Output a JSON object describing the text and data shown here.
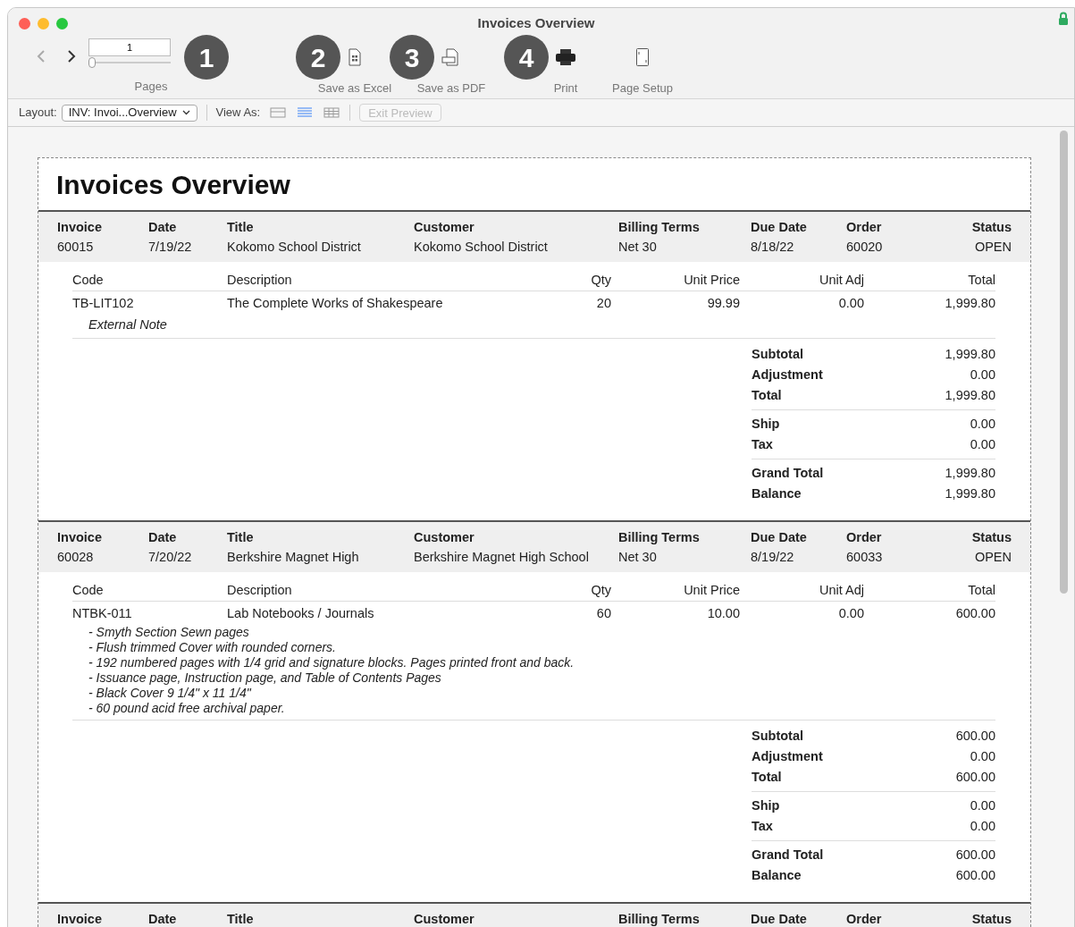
{
  "window": {
    "title": "Invoices Overview",
    "locked": true
  },
  "toolbar": {
    "page_field": {
      "value": "1"
    },
    "page_slider": {
      "level": 0
    },
    "pages_label": "Pages",
    "actions": [
      {
        "kind": "excel",
        "label": "Save as Excel"
      },
      {
        "kind": "pdf",
        "label": "Save as PDF"
      },
      {
        "kind": "print",
        "label": "Print"
      },
      {
        "kind": "setup",
        "label": "Page Setup"
      }
    ],
    "callouts": [
      "1",
      "2",
      "3",
      "4"
    ]
  },
  "layout_bar": {
    "layout_label": "Layout:",
    "layout_value": "INV: Invoi...Overview",
    "view_as_label": "View As:",
    "views": [
      {
        "kind": "form",
        "selected": false
      },
      {
        "kind": "list",
        "selected": true
      },
      {
        "kind": "table",
        "selected": false
      }
    ],
    "exit_preview": {
      "label": "Exit Preview",
      "disabled": true
    }
  },
  "report": {
    "title": "Invoices Overview",
    "invoices": [
      {
        "header": [
          {
            "label": "Invoice",
            "value": "60015"
          },
          {
            "label": "Date",
            "value": "7/19/22"
          },
          {
            "label": "Title",
            "value": "Kokomo School District"
          },
          {
            "label": "Customer",
            "value": "Kokomo School District"
          },
          {
            "label": "Billing Terms",
            "value": "Net 30"
          },
          {
            "label": "Due Date",
            "value": "8/18/22"
          },
          {
            "label": "Order",
            "value": "60020"
          },
          {
            "label": "Status",
            "value": "OPEN"
          }
        ],
        "item_columns": [
          "Code",
          "Description",
          "Qty",
          "Unit Price",
          "Unit Adj",
          "Total"
        ],
        "items": [
          {
            "cells": [
              "TB-LIT102",
              "The Complete Works of Shakespeare",
              "20",
              "99.99",
              "0.00",
              "1,999.80"
            ],
            "notes": [
              "External Note"
            ]
          }
        ],
        "totals": [
          [
            {
              "label": "Subtotal",
              "value": "1,999.80"
            },
            {
              "label": "Adjustment",
              "value": "0.00"
            },
            {
              "label": "Total",
              "value": "1,999.80"
            }
          ],
          [
            {
              "label": "Ship",
              "value": "0.00"
            },
            {
              "label": "Tax",
              "value": "0.00"
            }
          ],
          [
            {
              "label": "Grand Total",
              "value": "1,999.80"
            },
            {
              "label": "Balance",
              "value": "1,999.80"
            }
          ]
        ]
      },
      {
        "header": [
          {
            "label": "Invoice",
            "value": "60028"
          },
          {
            "label": "Date",
            "value": "7/20/22"
          },
          {
            "label": "Title",
            "value": "Berkshire Magnet High"
          },
          {
            "label": "Customer",
            "value": "Berkshire Magnet High School"
          },
          {
            "label": "Billing Terms",
            "value": "Net 30"
          },
          {
            "label": "Due Date",
            "value": "8/19/22"
          },
          {
            "label": "Order",
            "value": "60033"
          },
          {
            "label": "Status",
            "value": "OPEN"
          }
        ],
        "item_columns": [
          "Code",
          "Description",
          "Qty",
          "Unit Price",
          "Unit Adj",
          "Total"
        ],
        "items": [
          {
            "cells": [
              "NTBK-011",
              "Lab Notebooks / Journals",
              "60",
              "10.00",
              "0.00",
              "600.00"
            ],
            "notes": [
              "- Smyth Section Sewn pages",
              "- Flush trimmed Cover with rounded corners.",
              "- 192 numbered pages with 1/4 grid and signature blocks. Pages printed front and back.",
              "- Issuance page, Instruction page, and Table of Contents Pages",
              "- Black Cover 9 1/4\" x 11 1/4\"",
              "- 60 pound acid free archival paper."
            ]
          }
        ],
        "totals": [
          [
            {
              "label": "Subtotal",
              "value": "600.00"
            },
            {
              "label": "Adjustment",
              "value": "0.00"
            },
            {
              "label": "Total",
              "value": "600.00"
            }
          ],
          [
            {
              "label": "Ship",
              "value": "0.00"
            },
            {
              "label": "Tax",
              "value": "0.00"
            }
          ],
          [
            {
              "label": "Grand Total",
              "value": "600.00"
            },
            {
              "label": "Balance",
              "value": "600.00"
            }
          ]
        ]
      },
      {
        "header": [
          {
            "label": "Invoice"
          },
          {
            "label": "Date"
          },
          {
            "label": "Title"
          },
          {
            "label": "Customer"
          },
          {
            "label": "Billing Terms"
          },
          {
            "label": "Due Date"
          },
          {
            "label": "Order"
          },
          {
            "label": "Status"
          }
        ]
      }
    ]
  }
}
